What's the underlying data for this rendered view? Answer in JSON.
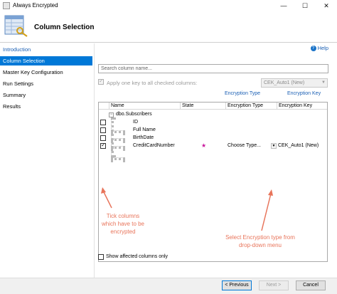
{
  "window": {
    "title": "Always Encrypted",
    "controls": {
      "minimize": "—",
      "maximize": "☐",
      "close": "✕"
    }
  },
  "header": {
    "title": "Column Selection"
  },
  "sidebar": {
    "items": [
      {
        "label": "Introduction",
        "state": "link"
      },
      {
        "label": "Column Selection",
        "state": "active"
      },
      {
        "label": "Master Key Configuration",
        "state": "normal"
      },
      {
        "label": "Run Settings",
        "state": "normal"
      },
      {
        "label": "Summary",
        "state": "normal"
      },
      {
        "label": "Results",
        "state": "normal"
      }
    ]
  },
  "help": {
    "label": "Help",
    "icon": "help-icon",
    "glyph": "?"
  },
  "search": {
    "placeholder": "Search column name..."
  },
  "apply_all": {
    "label": "Apply one key to all checked columns:",
    "checked": true,
    "disabled": true,
    "selected": "CEK_Auto1 (New)"
  },
  "column_links": {
    "encryption_type": "Encryption Type",
    "encryption_key": "Encryption Key"
  },
  "grid": {
    "headers": [
      "Name",
      "State",
      "Encryption Type",
      "Encryption Key"
    ],
    "table_name": "dbo.Subscribers",
    "expand_glyph": "−",
    "rows": [
      {
        "name": "ID",
        "checked": false,
        "state": "",
        "encryption_type": "",
        "encryption_key": ""
      },
      {
        "name": "Full Name",
        "checked": false,
        "state": "",
        "encryption_type": "",
        "encryption_key": ""
      },
      {
        "name": "BirthDate",
        "checked": false,
        "state": "",
        "encryption_type": "",
        "encryption_key": ""
      },
      {
        "name": "CreditCardNumber",
        "checked": true,
        "state": "★",
        "encryption_type": "Choose Type...",
        "encryption_key": "CEK_Auto1 (New)"
      }
    ]
  },
  "annotations": {
    "tick": "Tick columns which have to be encrypted",
    "select": "Select Encryption type from drop-down menu"
  },
  "show_affected": {
    "label": "Show affected columns only",
    "checked": false
  },
  "footer": {
    "previous": "< Previous",
    "next": "Next >",
    "cancel": "Cancel"
  },
  "colors": {
    "accent": "#0078d7",
    "link": "#1a5fb4",
    "annotation": "#e8745a",
    "state_star": "#c8169c"
  }
}
